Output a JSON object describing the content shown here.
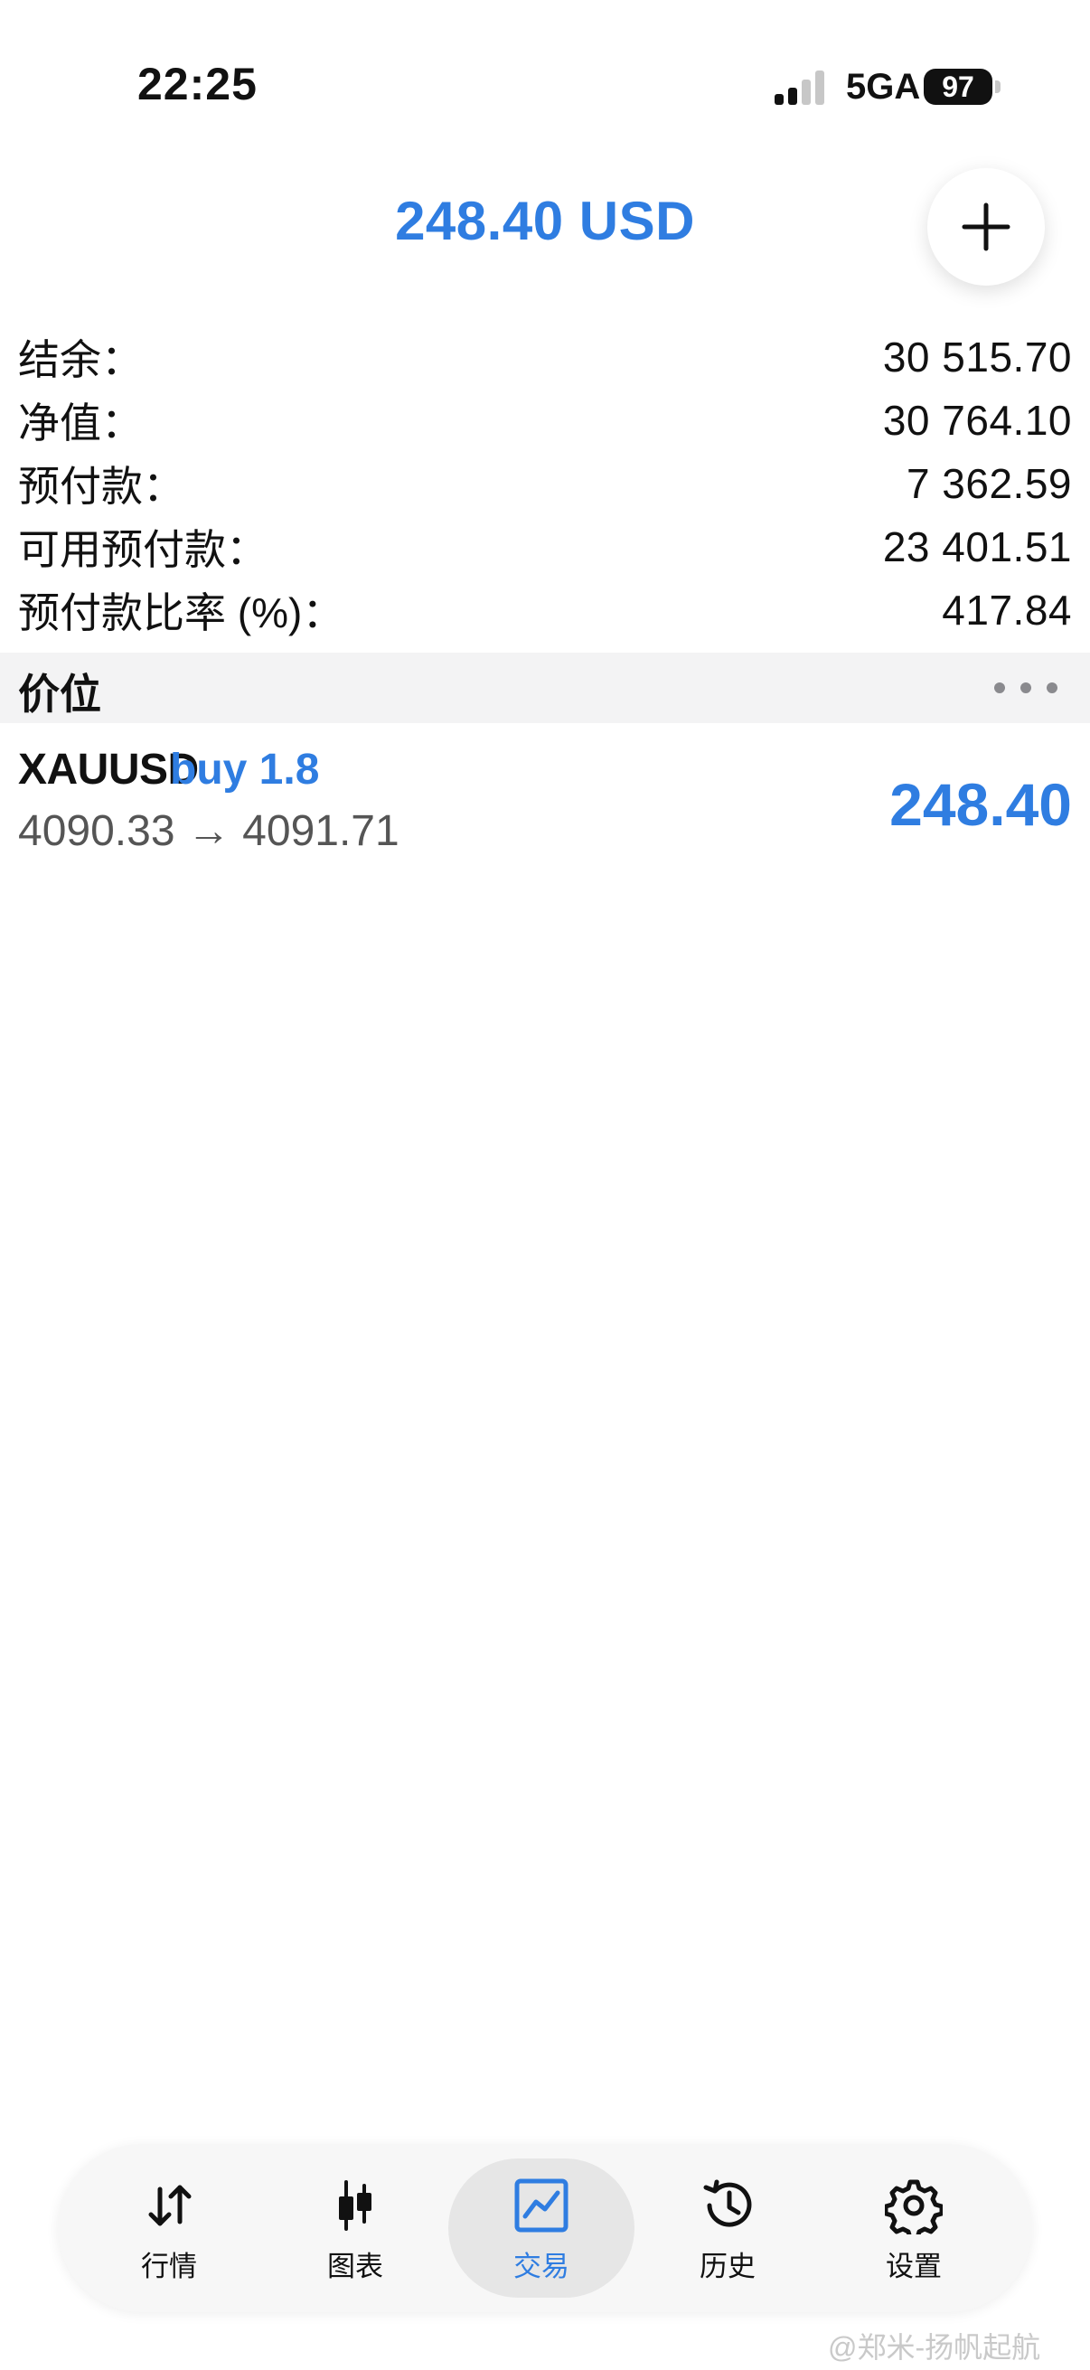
{
  "status_bar": {
    "time": "22:25",
    "network": "5GA",
    "battery": "97"
  },
  "header": {
    "total_profit": "248.40 USD",
    "add_icon": "plus-icon"
  },
  "account": {
    "rows": [
      {
        "label": "结余：",
        "value": "30 515.70"
      },
      {
        "label": "净值：",
        "value": "30 764.10"
      },
      {
        "label": "预付款：",
        "value": "7 362.59"
      },
      {
        "label": "可用预付款：",
        "value": "23 401.51"
      },
      {
        "label": "预付款比率 (%)：",
        "value": "417.84"
      }
    ]
  },
  "positions": {
    "title": "价位",
    "more_icon": "ellipsis-icon",
    "items": [
      {
        "symbol": "XAUUSD",
        "direction": "buy 1.8",
        "prices": "4090.33 → 4091.71",
        "profit": "248.40"
      }
    ]
  },
  "tabs": [
    {
      "label": "行情",
      "icon": "quotes-arrows-icon",
      "active": false
    },
    {
      "label": "图表",
      "icon": "candlestick-chart-icon",
      "active": false
    },
    {
      "label": "交易",
      "icon": "trade-chart-icon",
      "active": true
    },
    {
      "label": "历史",
      "icon": "history-clock-icon",
      "active": false
    },
    {
      "label": "设置",
      "icon": "gear-icon",
      "active": false
    }
  ],
  "watermark": "@郑米-扬帆起航",
  "colors": {
    "accent": "#2f7de1",
    "text": "#111111",
    "section_bg": "#f3f3f4",
    "tab_active_bg": "#e6e6e6"
  }
}
